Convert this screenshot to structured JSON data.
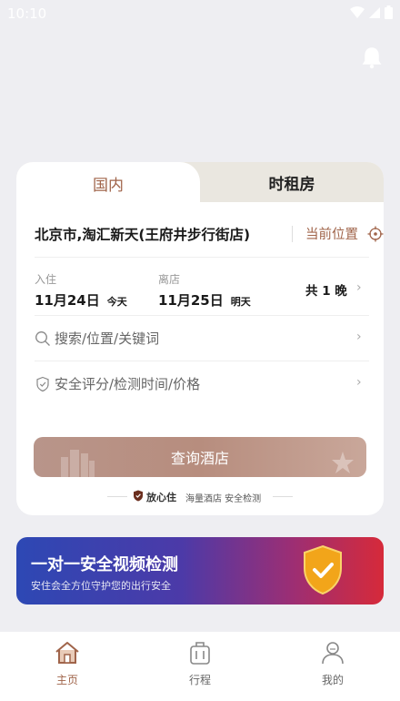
{
  "status_bar": {
    "time": "10:10"
  },
  "tabs": {
    "domestic": "国内",
    "hourly": "时租房"
  },
  "location": {
    "text": "北京市,淘汇新天(王府井步行街店)",
    "current_location": "当前位置"
  },
  "dates": {
    "checkin_label": "入住",
    "checkin_date": "11月24日",
    "checkin_sub": "今天",
    "checkout_label": "离店",
    "checkout_date": "11月25日",
    "checkout_sub": "明天",
    "nights": "共 1 晚"
  },
  "search": {
    "placeholder": "搜索/位置/关键词"
  },
  "filter": {
    "label": "安全评分/检测时间/价格"
  },
  "query_button": {
    "label": "查询酒店"
  },
  "assurance": {
    "brand": "放心住",
    "text": "海量酒店 安全检测"
  },
  "banner": {
    "title": "一对一安全视频检测",
    "subtitle": "安住会全方位守护您的出行安全"
  },
  "tabbar": {
    "items": [
      {
        "label": "主页",
        "icon": "home-icon",
        "active": true
      },
      {
        "label": "行程",
        "icon": "luggage-icon",
        "active": false
      },
      {
        "label": "我的",
        "icon": "profile-icon",
        "active": false
      }
    ]
  },
  "colors": {
    "accent": "#a0644a",
    "background": "#eeeef2",
    "button": "#b78d7e",
    "banner_start": "#2d48b4",
    "banner_end": "#d62a3a",
    "shield": "#f2a51a"
  }
}
